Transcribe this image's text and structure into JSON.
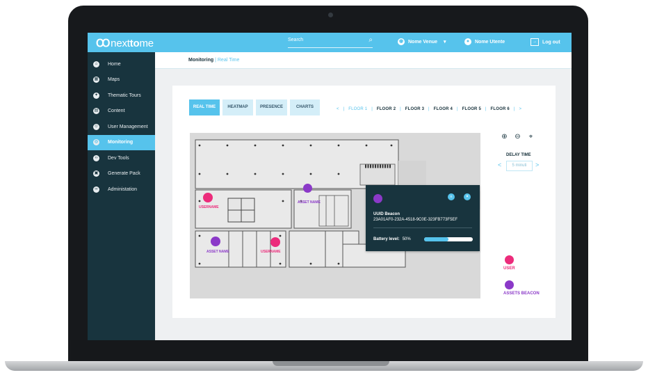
{
  "topbar": {
    "logo_mark": "Ꝏ",
    "logo_pre": "next",
    "logo_bold": "to",
    "logo_post": "me",
    "search_placeholder": "Search",
    "venue": "Nome Venue",
    "user": "Nome Utente",
    "logout": "Log out"
  },
  "sidebar": {
    "items": [
      {
        "label": "Home",
        "icon": "home-icon"
      },
      {
        "label": "Maps",
        "icon": "map-icon"
      },
      {
        "label": "Thematic Tours",
        "icon": "tour-icon"
      },
      {
        "label": "Content",
        "icon": "content-icon"
      },
      {
        "label": "User Management",
        "icon": "users-icon"
      },
      {
        "label": "Monitoring",
        "icon": "monitoring-icon",
        "active": true
      },
      {
        "label": "Dev Tools",
        "icon": "code-icon"
      },
      {
        "label": "Generate Pack",
        "icon": "pack-icon"
      },
      {
        "label": "Administation",
        "icon": "admin-icon"
      }
    ]
  },
  "breadcrumb": {
    "section": "Monitoring",
    "separator": " | ",
    "page": "Real Time"
  },
  "tabs": [
    "REAL TIME",
    "HEATMAP",
    "PRESENCE",
    "CHARTS"
  ],
  "floors": [
    "FLOOR 1",
    "FLOOR 2",
    "FLOOR 3",
    "FLOOR 4",
    "FLOOR 5",
    "FLOOR 6"
  ],
  "floor_nav": {
    "prev": "<",
    "next": ">",
    "sep": "|"
  },
  "delay": {
    "label": "DELAY TIME",
    "value": "5 minuti",
    "prev": "<",
    "next": ">"
  },
  "map_labels": {
    "username_1": "USERNAME",
    "username_2": "USERNAME",
    "asset_1": "ASSET NAME",
    "asset_2": "ASSET NAME"
  },
  "popup": {
    "title": "UUID Beacon",
    "uuid": "23A01AF0-232A-4518-9C0E-323FB773F5EF",
    "battery_label": "Battery level:",
    "battery_value": "50%",
    "battery_fraction": 0.5
  },
  "legend": {
    "user": "USER",
    "assets": "ASSETS BEACON"
  },
  "colors": {
    "accent": "#56c3ec",
    "sidebar": "#18343e",
    "user": "#ec2c7b",
    "asset": "#8b39c8"
  }
}
